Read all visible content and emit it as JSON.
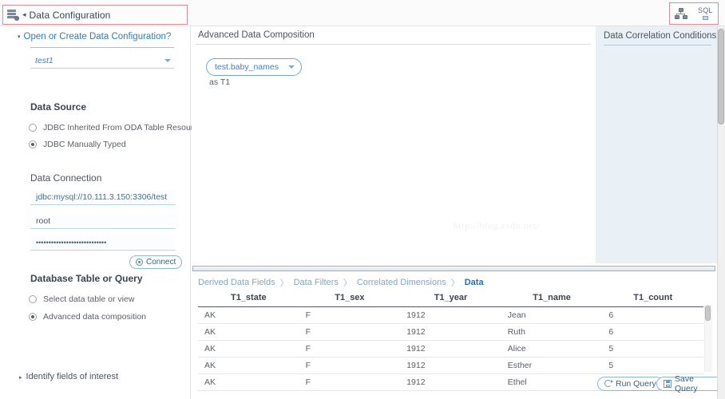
{
  "window": {
    "title": "Data Configuration",
    "back_arrow": "◂",
    "accent_blue": "#2f7fa8",
    "highlight_border": "#e08a93",
    "panel_blue_bg": "#e9f1f7"
  },
  "toolbar": {
    "tree_icon_name": "correlation-tree-icon",
    "sql_label": "SQL"
  },
  "sidebar": {
    "open_create": {
      "label": "Open or Create Data Configuration?",
      "expanded_marker": "▾"
    },
    "config_select": {
      "value": "test1"
    },
    "data_source": {
      "heading": "Data Source",
      "options": [
        {
          "label": "JDBC Inherited From ODA Table Resource",
          "checked": false
        },
        {
          "label": "JDBC Manually Typed",
          "checked": true
        }
      ]
    },
    "data_connection": {
      "heading": "Data Connection",
      "url": "jdbc:mysql://10.111.3.150:3306/test",
      "user": "root",
      "password_mask": "••••••••••••••••••••••••••••",
      "connect_label": "Connect"
    },
    "database_table_or_query": {
      "heading": "Database Table or Query",
      "options": [
        {
          "label": "Select data table or view",
          "checked": false
        },
        {
          "label": "Advanced data composition",
          "checked": true
        }
      ]
    },
    "identify_fields": {
      "label": "Identify fields of interest",
      "collapsed_marker": "▸"
    }
  },
  "center": {
    "title": "Advanced Data Composition",
    "table_select": {
      "value": "test.baby_names"
    },
    "alias": "as T1",
    "watermark": "http://blog.csdn.net/"
  },
  "right": {
    "title": "Data Correlation Conditions"
  },
  "bottom": {
    "breadcrumb": [
      {
        "label": "Derived Data Fields",
        "active": false
      },
      {
        "label": "Data Filters",
        "active": false
      },
      {
        "label": "Correlated Dimensions",
        "active": false
      },
      {
        "label": "Data",
        "active": true
      }
    ],
    "separator": "〉",
    "grid": {
      "columns": [
        "T1_state",
        "T1_sex",
        "T1_year",
        "T1_name",
        "T1_count"
      ],
      "rows": [
        [
          "AK",
          "F",
          "1912",
          "Jean",
          "6"
        ],
        [
          "AK",
          "F",
          "1912",
          "Ruth",
          "6"
        ],
        [
          "AK",
          "F",
          "1912",
          "Alice",
          "5"
        ],
        [
          "AK",
          "F",
          "1912",
          "Esther",
          "5"
        ],
        [
          "AK",
          "F",
          "1912",
          "Ethel",
          "5"
        ]
      ]
    },
    "run_query_label": "Run Query",
    "save_query_label": "Save Query"
  }
}
